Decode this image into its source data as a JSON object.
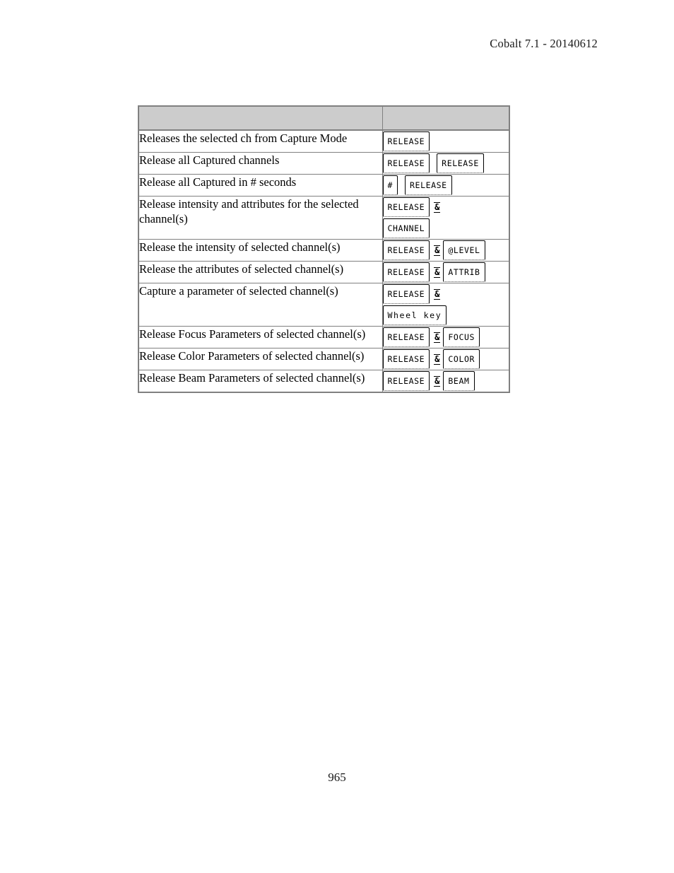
{
  "header": {
    "running_head": "Cobalt 7.1 - 20140612"
  },
  "footer": {
    "page_number": "965"
  },
  "table": {
    "header_row": {
      "description_header": "",
      "keys_header": ""
    },
    "rows": [
      {
        "description": "Releases the selected ch from Capture Mode",
        "key_lines": [
          [
            {
              "type": "key",
              "label": "RELEASE"
            }
          ]
        ]
      },
      {
        "description": "Release all Captured channels",
        "key_lines": [
          [
            {
              "type": "key",
              "label": "RELEASE"
            },
            {
              "type": "gap"
            },
            {
              "type": "key",
              "label": "RELEASE"
            }
          ]
        ]
      },
      {
        "description": "Release all Captured in # seconds",
        "key_lines": [
          [
            {
              "type": "key",
              "label": "#"
            },
            {
              "type": "gap"
            },
            {
              "type": "key",
              "label": "RELEASE"
            }
          ]
        ]
      },
      {
        "description": "Release intensity and attributes for the selected channel(s)",
        "key_lines": [
          [
            {
              "type": "key",
              "label": "RELEASE"
            },
            {
              "type": "amp",
              "label": "&"
            }
          ],
          [
            {
              "type": "key",
              "label": "CHANNEL"
            }
          ]
        ]
      },
      {
        "description": "Release the intensity of selected channel(s)",
        "key_lines": [
          [
            {
              "type": "key",
              "label": "RELEASE"
            },
            {
              "type": "amp",
              "label": "&"
            },
            {
              "type": "key",
              "label": "@LEVEL"
            }
          ]
        ]
      },
      {
        "description": "Release the attributes of selected channel(s)",
        "key_lines": [
          [
            {
              "type": "key",
              "label": "RELEASE"
            },
            {
              "type": "amp",
              "label": "&"
            },
            {
              "type": "key",
              "label": "ATTRIB"
            }
          ]
        ]
      },
      {
        "description": "Capture a parameter of selected channel(s)",
        "key_lines": [
          [
            {
              "type": "key",
              "label": "RELEASE"
            },
            {
              "type": "amp",
              "label": "&"
            }
          ],
          [
            {
              "type": "key",
              "label": "Wheel key",
              "spaced": true
            }
          ]
        ]
      },
      {
        "description": "Release Focus Parameters of selected channel(s)",
        "key_lines": [
          [
            {
              "type": "key",
              "label": "RELEASE"
            },
            {
              "type": "amp",
              "label": "&"
            },
            {
              "type": "key",
              "label": "FOCUS"
            }
          ]
        ]
      },
      {
        "description": "Release Color Parameters of selected channel(s)",
        "key_lines": [
          [
            {
              "type": "key",
              "label": "RELEASE"
            },
            {
              "type": "amp",
              "label": "&"
            },
            {
              "type": "key",
              "label": "COLOR"
            }
          ]
        ]
      },
      {
        "description": "Release Beam Parameters of selected channel(s)",
        "key_lines": [
          [
            {
              "type": "key",
              "label": "RELEASE"
            },
            {
              "type": "amp",
              "label": "&"
            },
            {
              "type": "key",
              "label": "BEAM"
            }
          ]
        ]
      }
    ]
  },
  "colors": {
    "header_fill": "#cccccc",
    "table_border": "#808080",
    "text": "#000000",
    "page_background": "#ffffff"
  }
}
